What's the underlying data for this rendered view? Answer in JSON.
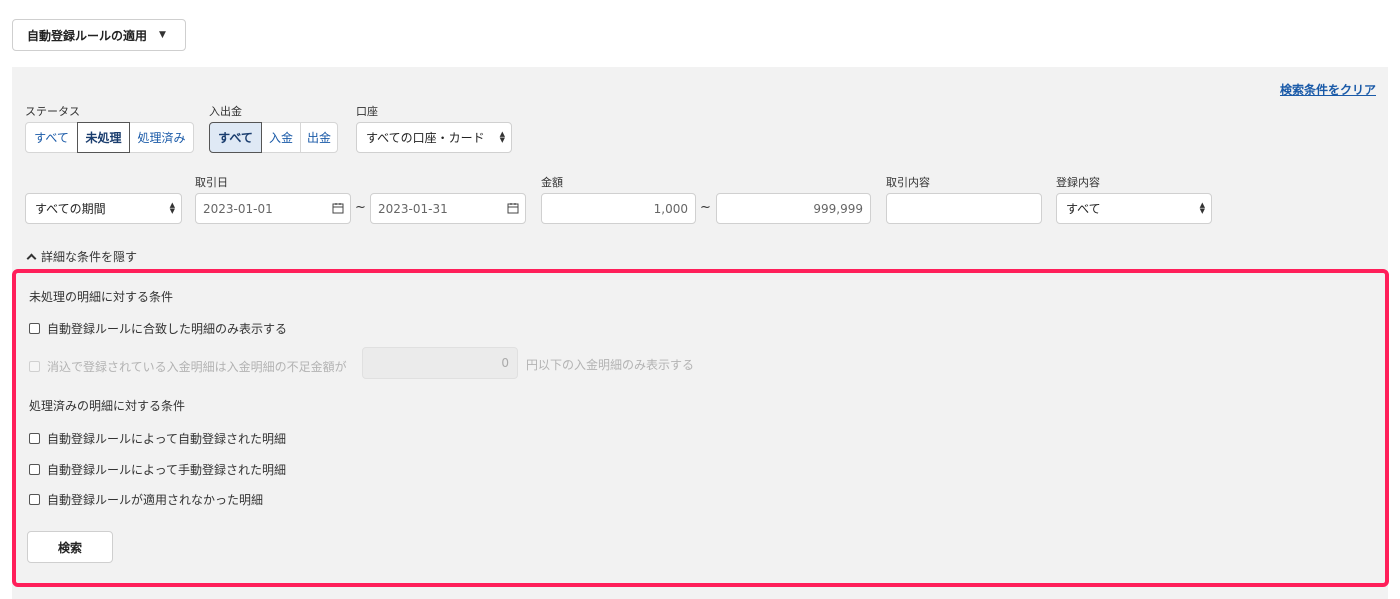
{
  "header": {
    "apply_rules_button": "自動登録ルールの適用"
  },
  "filters": {
    "clear_link": "検索条件をクリア",
    "status": {
      "label": "ステータス",
      "options": [
        "すべて",
        "未処理",
        "処理済み"
      ],
      "selected": "未処理"
    },
    "in_out": {
      "label": "入出金",
      "options": [
        "すべて",
        "入金",
        "出金"
      ],
      "selected": "すべて"
    },
    "account": {
      "label": "口座",
      "value": "すべての口座・カード"
    },
    "period": {
      "value": "すべての期間"
    },
    "trade_date": {
      "label": "取引日",
      "from": "2023-01-01",
      "to": "2023-01-31",
      "sep": "~"
    },
    "amount": {
      "label": "金額",
      "from": "1,000",
      "to": "999,999",
      "sep": "~"
    },
    "description": {
      "label": "取引内容",
      "value": ""
    },
    "registration": {
      "label": "登録内容",
      "value": "すべて"
    },
    "toggle_label": "詳細な条件を隠す"
  },
  "detail": {
    "unprocessed_title": "未処理の明細に対する条件",
    "unprocessed_match_only": "自動登録ルールに合致した明細のみ表示する",
    "shortfall_prefix": "消込で登録されている入金明細は入金明細の不足金額が",
    "shortfall_value": "0",
    "shortfall_suffix": "円以下の入金明細のみ表示する",
    "processed_title": "処理済みの明細に対する条件",
    "processed_auto": "自動登録ルールによって自動登録された明細",
    "processed_manual": "自動登録ルールによって手動登録された明細",
    "processed_not_applied": "自動登録ルールが適用されなかった明細",
    "search_button": "検索"
  },
  "colors": {
    "highlight_border": "#ff1f5a",
    "link": "#1a5aa8",
    "panel_bg": "#f2f2f2"
  }
}
